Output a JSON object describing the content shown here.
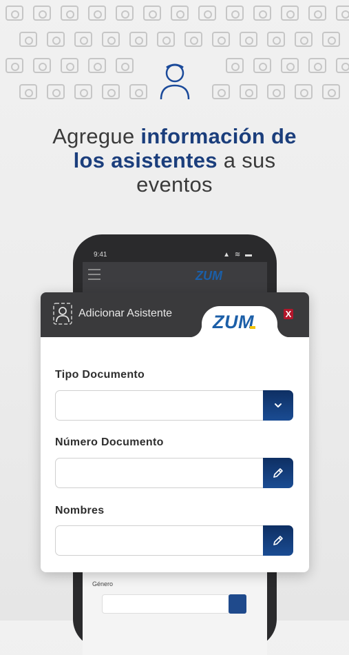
{
  "headline": {
    "part1": "Agregue ",
    "highlight1": "información de",
    "highlight2": "los asistentes",
    "part2": " a sus",
    "part3": "eventos"
  },
  "phone": {
    "time": "9:41",
    "status": "▲ ≋ ▬",
    "brand": "ZUM",
    "field_label": "Género"
  },
  "modal": {
    "title": "Adicionar Asistente",
    "brand": "ZUM",
    "close_label": "X",
    "fields": [
      {
        "label": "Tipo Documento",
        "value": "",
        "button_icon": "chevron-down-icon"
      },
      {
        "label": "Número Documento",
        "value": "",
        "button_icon": "pencil-icon"
      },
      {
        "label": "Nombres",
        "value": "",
        "button_icon": "pencil-icon"
      }
    ]
  },
  "colors": {
    "accent": "#1b3e7c",
    "header": "#3a3a3c",
    "close": "#b4162b",
    "logo": "#1c5fa8"
  }
}
